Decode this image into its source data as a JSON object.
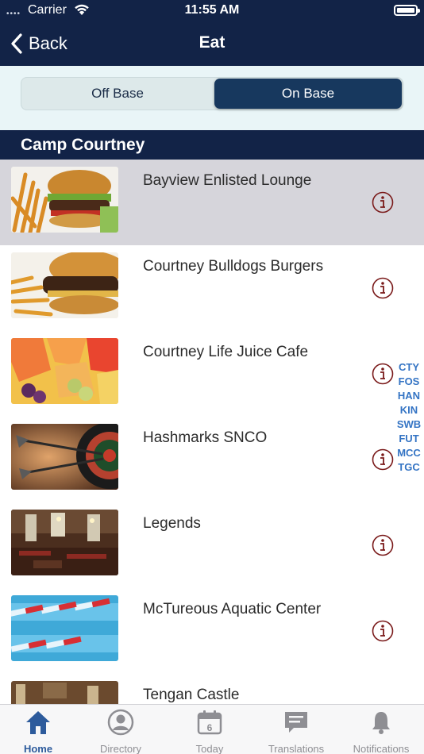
{
  "status_bar": {
    "carrier": "Carrier",
    "time": "11:55 AM"
  },
  "nav": {
    "back_label": "Back",
    "title": "Eat"
  },
  "segments": {
    "off_base": "Off Base",
    "on_base": "On Base",
    "selected": "On Base"
  },
  "section_title": "Camp Courtney",
  "items": [
    {
      "name": "Bayview Enlisted Lounge",
      "image": "burger-fries-photo",
      "selected": true
    },
    {
      "name": "Courtney Bulldogs Burgers",
      "image": "burger-fries-photo"
    },
    {
      "name": "Courtney Life Juice Cafe",
      "image": "fruit-photo"
    },
    {
      "name": "Hashmarks SNCO",
      "image": "darts-photo"
    },
    {
      "name": "Legends",
      "image": "dining-room-photo"
    },
    {
      "name": "McTureous Aquatic Center",
      "image": "pool-lanes-photo"
    },
    {
      "name": "Tengan Castle",
      "image": "interior-photo"
    }
  ],
  "section_index": [
    "CTY",
    "FOS",
    "HAN",
    "KIN",
    "SWB",
    "FUT",
    "MCC",
    "TGC"
  ],
  "tabs": [
    {
      "label": "Home",
      "icon": "home-icon",
      "active": true
    },
    {
      "label": "Directory",
      "icon": "person-icon"
    },
    {
      "label": "Today",
      "icon": "calendar-icon"
    },
    {
      "label": "Translations",
      "icon": "chat-icon"
    },
    {
      "label": "Notifications",
      "icon": "bell-icon"
    }
  ],
  "colors": {
    "navy": "#122347",
    "active_tab": "#2d5b9c",
    "info_icon": "#7a1a1a",
    "index_link": "#3474c4"
  }
}
